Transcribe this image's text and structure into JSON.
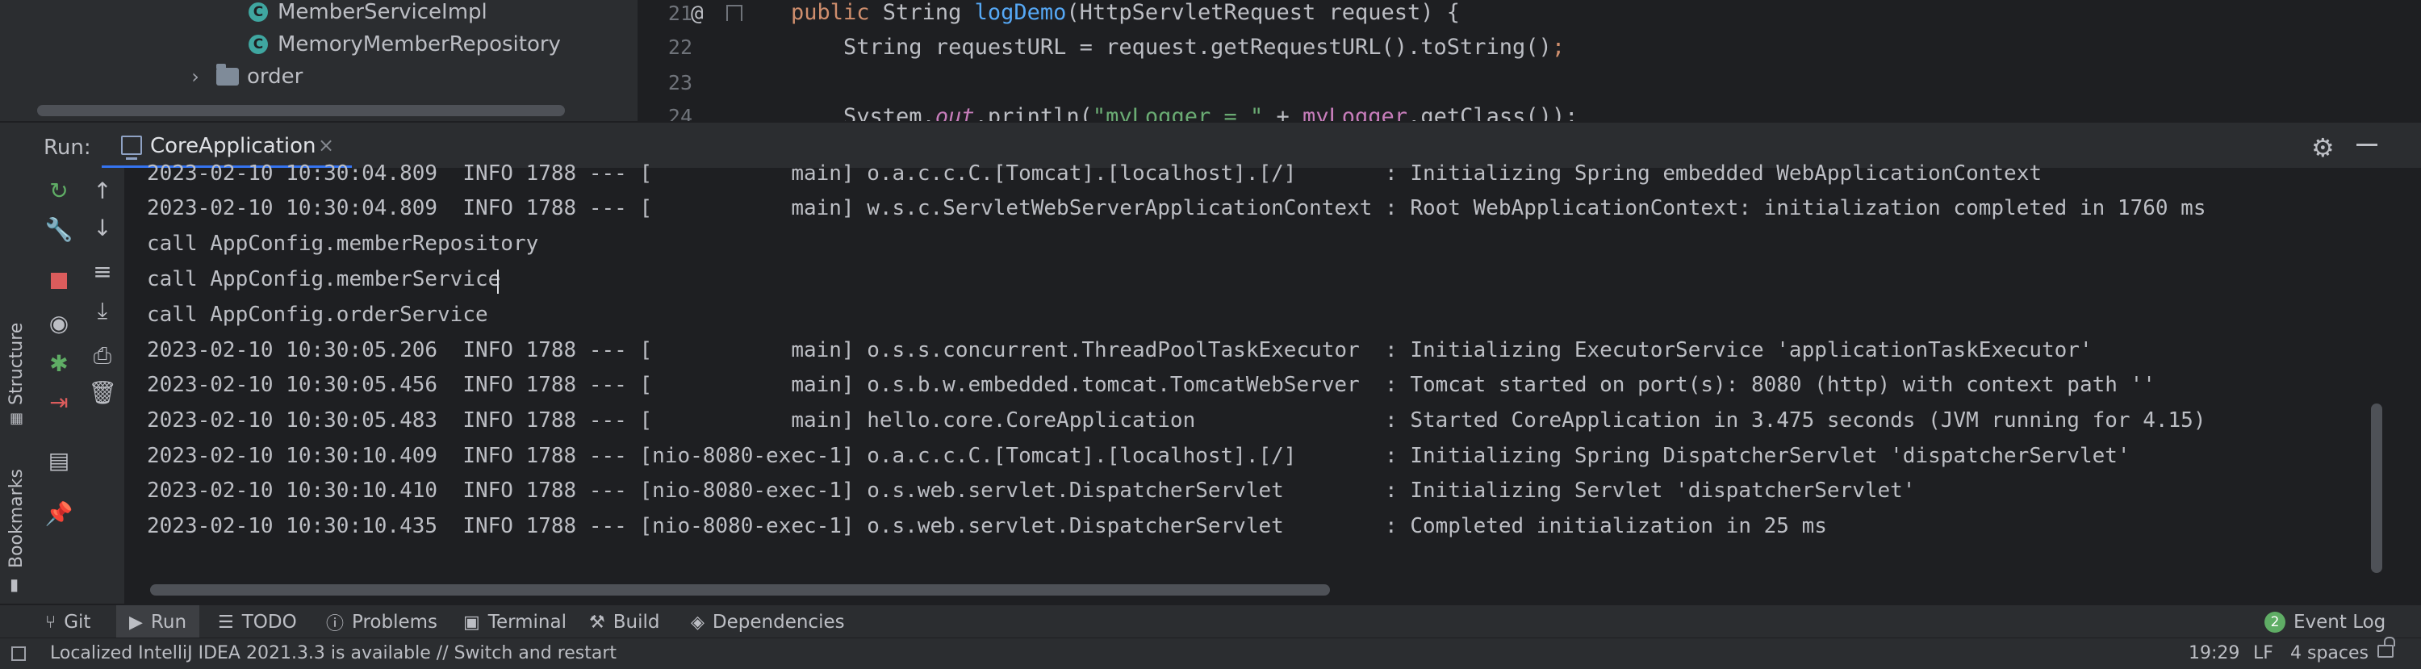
{
  "project_tree": {
    "items": [
      {
        "label": "MemberServiceImpl",
        "kind": "class",
        "icon": "class-icon",
        "icon_letter": "C"
      },
      {
        "label": "MemoryMemberRepository",
        "kind": "class",
        "icon": "class-icon",
        "icon_letter": "C"
      },
      {
        "label": "order",
        "kind": "package",
        "icon": "folder-icon"
      }
    ]
  },
  "editor": {
    "line_numbers": [
      "21",
      "22",
      "23",
      "24"
    ],
    "gutter_marker": "@",
    "lines": [
      {
        "t1": "public",
        "t2": " String ",
        "t3": "logDemo",
        "t4": "(HttpServletRequest request) {"
      },
      {
        "t1": "    String requestURL = request.getRequestURL().toString()",
        "t2": ";"
      },
      {
        "t1": ""
      },
      {
        "t1": "    System.",
        "t2": "out",
        "t3": ".println(",
        "t4": "\"myLogger = \"",
        "t5": " + ",
        "t6": "myLogger",
        "t7": ".getClass());"
      }
    ]
  },
  "run_window": {
    "label": "Run:",
    "tab_label": "CoreApplication",
    "tab_close": "×",
    "settings_icon": "gear-icon",
    "minimize_icon": "minimize-icon"
  },
  "left_rail": {
    "structure_label": "Structure",
    "bookmarks_label": "Bookmarks"
  },
  "console": {
    "lines": [
      "2023-02-10 10:30:04.809  INFO 1788 --- [           main] o.a.c.c.C.[Tomcat].[localhost].[/]       : Initializing Spring embedded WebApplicationContext",
      "2023-02-10 10:30:04.809  INFO 1788 --- [           main] w.s.c.ServletWebServerApplicationContext : Root WebApplicationContext: initialization completed in 1760 ms",
      "call AppConfig.memberRepository",
      "call AppConfig.memberService",
      "call AppConfig.orderService",
      "2023-02-10 10:30:05.206  INFO 1788 --- [           main] o.s.s.concurrent.ThreadPoolTaskExecutor  : Initializing ExecutorService 'applicationTaskExecutor'",
      "2023-02-10 10:30:05.456  INFO 1788 --- [           main] o.s.b.w.embedded.tomcat.TomcatWebServer  : Tomcat started on port(s): 8080 (http) with context path ''",
      "2023-02-10 10:30:05.483  INFO 1788 --- [           main] hello.core.CoreApplication               : Started CoreApplication in 3.475 seconds (JVM running for 4.15)",
      "2023-02-10 10:30:10.409  INFO 1788 --- [nio-8080-exec-1] o.a.c.c.C.[Tomcat].[localhost].[/]       : Initializing Spring DispatcherServlet 'dispatcherServlet'",
      "2023-02-10 10:30:10.410  INFO 1788 --- [nio-8080-exec-1] o.s.web.servlet.DispatcherServlet        : Initializing Servlet 'dispatcherServlet'",
      "2023-02-10 10:30:10.435  INFO 1788 --- [nio-8080-exec-1] o.s.web.servlet.DispatcherServlet        : Completed initialization in 25 ms"
    ]
  },
  "bottom_bar": {
    "git": "Git",
    "run": "Run",
    "todo": "TODO",
    "problems": "Problems",
    "terminal": "Terminal",
    "build": "Build",
    "dependencies": "Dependencies",
    "event_log": "Event Log",
    "event_count": "2"
  },
  "status_bar": {
    "message": "Localized IntelliJ IDEA 2021.3.3 is available // Switch and restart",
    "position": "19:29",
    "line_sep": "LF",
    "indent": "4 spaces"
  },
  "colors": {
    "accent": "#3574f0",
    "stop_red": "#db5c5c",
    "rerun_green": "#5fad65",
    "badge_green": "#5fad65"
  }
}
